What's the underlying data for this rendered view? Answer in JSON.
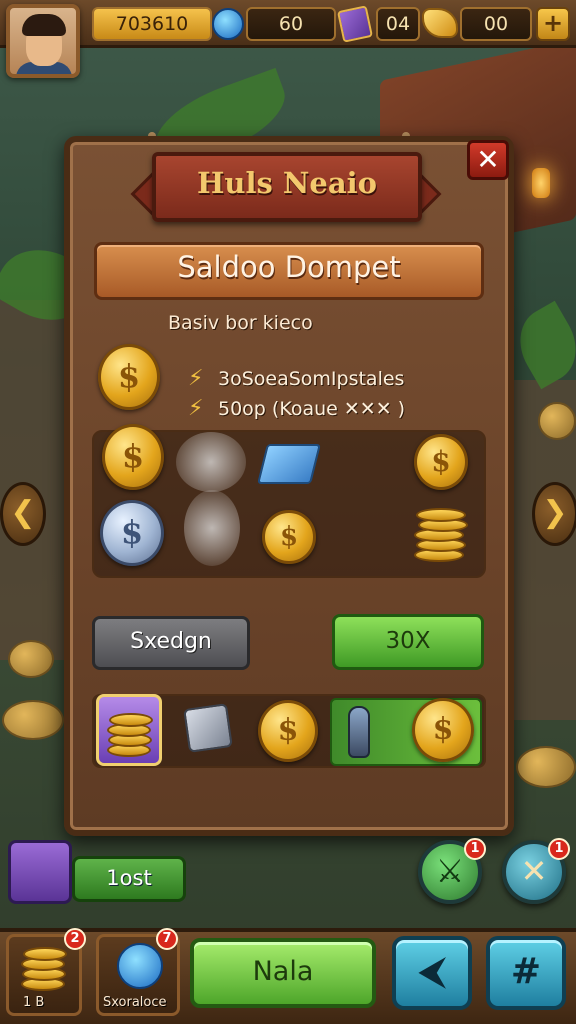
{
  "topbar": {
    "resource_1": "703610",
    "resource_2": "60",
    "resource_3": "04",
    "resource_4": "00",
    "plus_label": "+"
  },
  "panel": {
    "banner_title": "Huls Neaio",
    "close_label": "✕",
    "title": "Saldoo Dompet",
    "subtitle": "Basiv bor kieco",
    "stat_1": "3oSoeaSomIpstales",
    "stat_2": "50op (Koaue ✕✕✕ )",
    "coin_symbol": "$",
    "left_button": "Sxedgn",
    "right_button": "30X"
  },
  "hud": {
    "left_arrow": "❮",
    "right_arrow": "❯",
    "lost_button": "1ost",
    "badge_1": "1",
    "badge_2": "1",
    "close_round": "✕"
  },
  "bottombar": {
    "slot_1_label": "1 B",
    "slot_1_badge": "2",
    "slot_2_label": "Sxoraloce",
    "slot_2_badge": "7",
    "main_button": "Nala",
    "sq_btn_1": "⮜",
    "sq_btn_2": "#"
  },
  "colors": {
    "accent_gold": "#f3c86d",
    "button_green": "#4ea62a",
    "button_cyan": "#1f7fa0",
    "close_red": "#d13a2a"
  }
}
